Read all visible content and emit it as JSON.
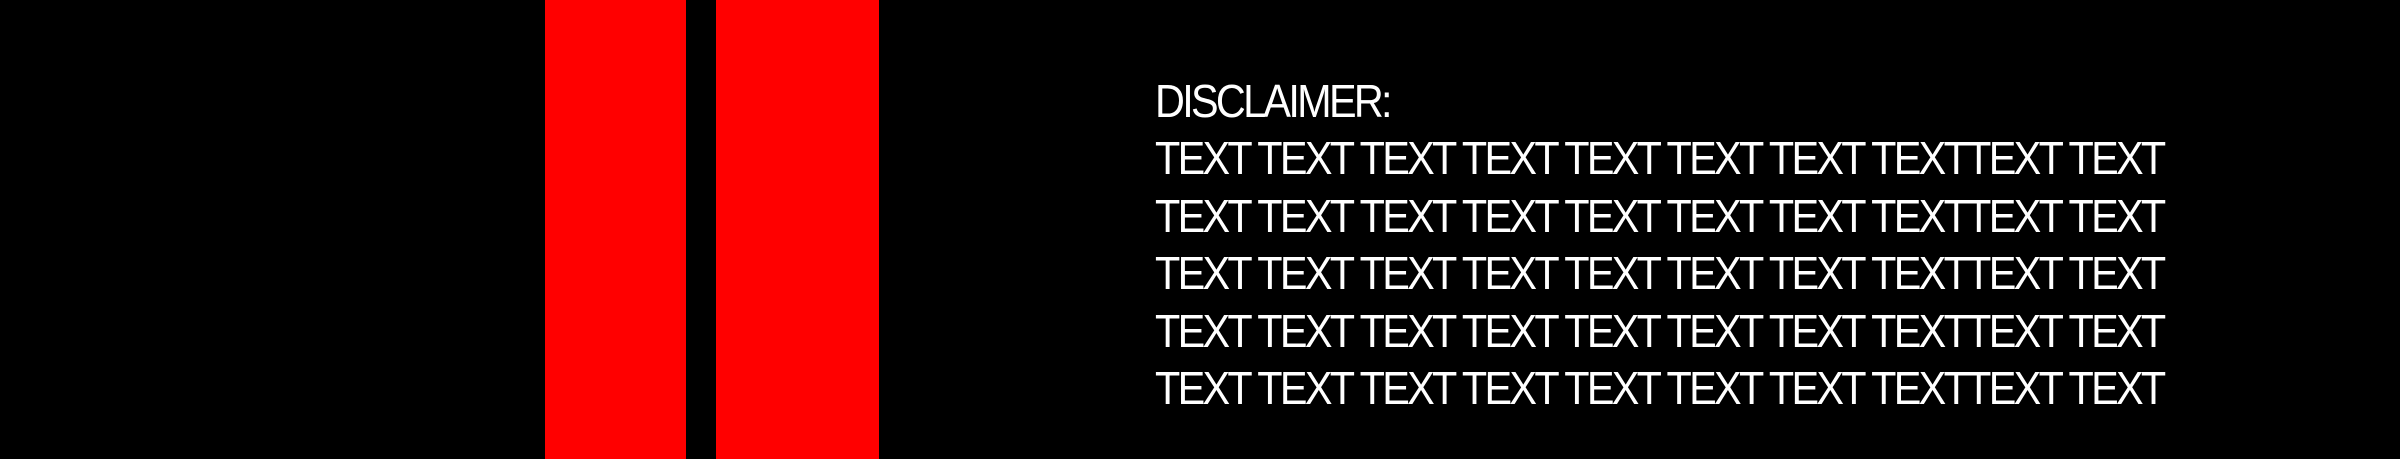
{
  "disclaimer": {
    "heading": "DISCLAIMER:",
    "lines": [
      "TEXT TEXT TEXT TEXT TEXT TEXT TEXT TEXTTEXT TEXT",
      "TEXT TEXT TEXT TEXT TEXT TEXT TEXT TEXTTEXT TEXT",
      "TEXT TEXT TEXT TEXT TEXT TEXT TEXT TEXTTEXT TEXT",
      "TEXT TEXT TEXT TEXT TEXT TEXT TEXT TEXTTEXT TEXT",
      "TEXT TEXT TEXT TEXT TEXT TEXT TEXT TEXTTEXT TEXT"
    ]
  },
  "colors": {
    "background": "#000000",
    "stripe": "#ff0000",
    "text": "#ffffff"
  }
}
